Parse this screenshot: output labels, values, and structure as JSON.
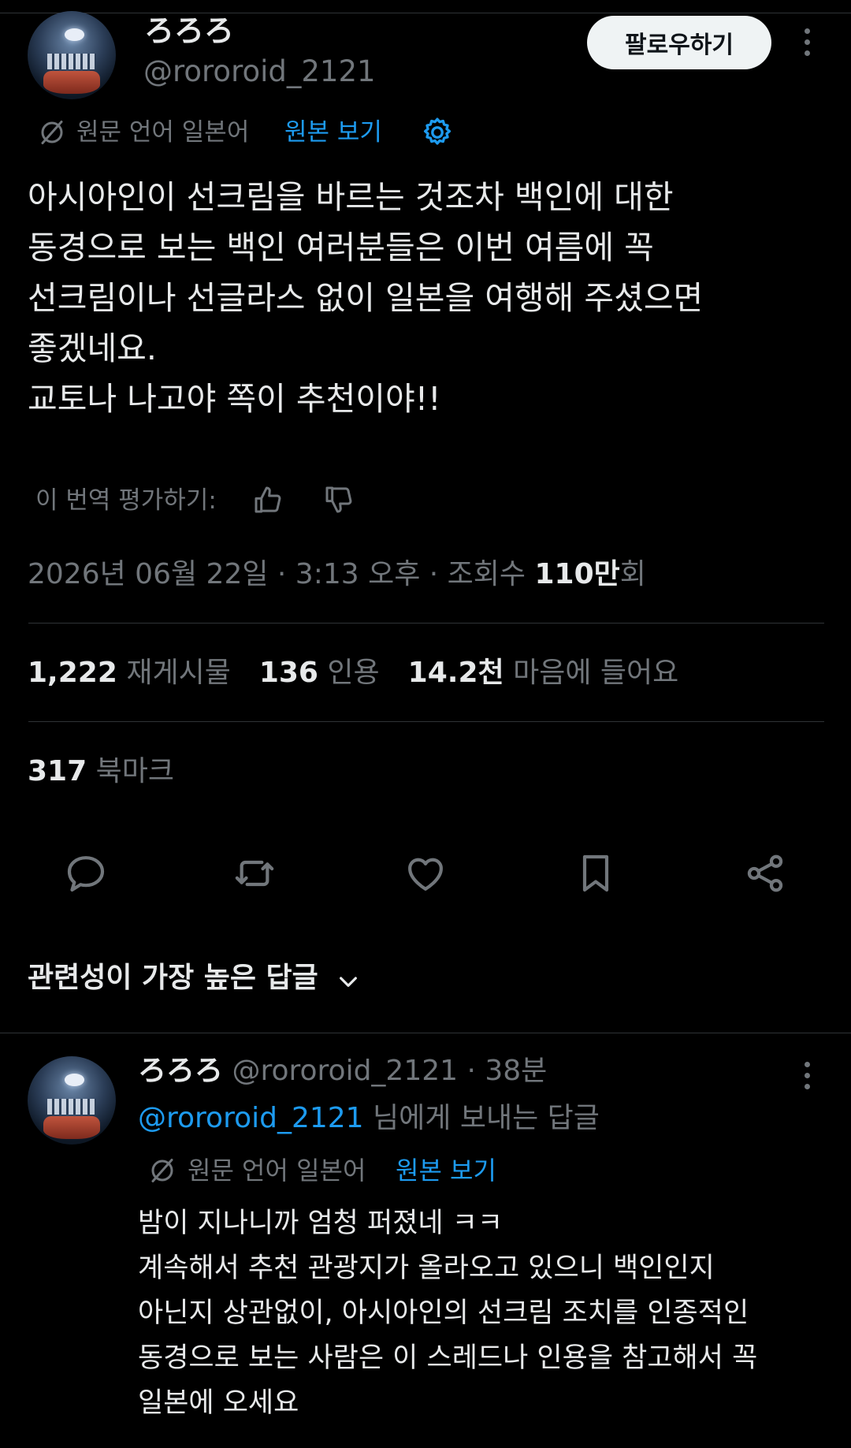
{
  "tweet": {
    "display_name": "ろろろ",
    "handle": "@rororoid_2121",
    "follow_label": "팔로우하기",
    "translation": {
      "source_text": "원문 언어 일본어",
      "view_original": "원본 보기"
    },
    "body": "아시아인이 선크림을 바르는 것조차 백인에 대한\n동경으로 보는 백인 여러분들은 이번 여름에 꼭\n선크림이나 선글라스 없이 일본을 여행해 주셨으면\n좋겠네요.\n교토나 나고야 쪽이 추천이야!!",
    "rate_translation": "이 번역 평가하기:",
    "timestamp": "2026년 06월 22일 · 3:13 오후 · 조회수 ",
    "views_number": "110만",
    "views_suffix": "회",
    "stats": {
      "retweets_count": "1,222",
      "retweets_label": "재게시물",
      "quotes_count": "136",
      "quotes_label": "인용",
      "likes_count": "14.2천",
      "likes_label": "마음에 들어요",
      "bookmarks_count": "317",
      "bookmarks_label": "북마크"
    },
    "actions": [
      "reply-icon",
      "retweet-icon",
      "heart-icon",
      "bookmark-icon",
      "share-icon"
    ]
  },
  "sort": {
    "label": "관련성이 가장 높은 답글"
  },
  "reply": {
    "display_name": "ろろろ",
    "handle_time": "@rororoid_2121 · 38분",
    "replying_to_handle": "@rororoid_2121",
    "replying_to_suffix": " 님에게 보내는 답글",
    "translation": {
      "source_text": "원문 언어 일본어",
      "view_original": "원본 보기"
    },
    "body": "밤이 지나니까 엄청 퍼졌네 ㅋㅋ\n계속해서 추천 관광지가 올라오고 있으니 백인인지\n아닌지 상관없이, 아시아인의 선크림 조치를 인종적인\n동경으로 보는 사람은 이 스레드나 인용을 참고해서 꼭\n일본에 오세요"
  },
  "colors": {
    "background": "#000000",
    "text": "#e7e9ea",
    "muted": "#71767b",
    "link": "#1d9bf0",
    "divider": "#2f3336",
    "follow_bg": "#eff3f4"
  }
}
